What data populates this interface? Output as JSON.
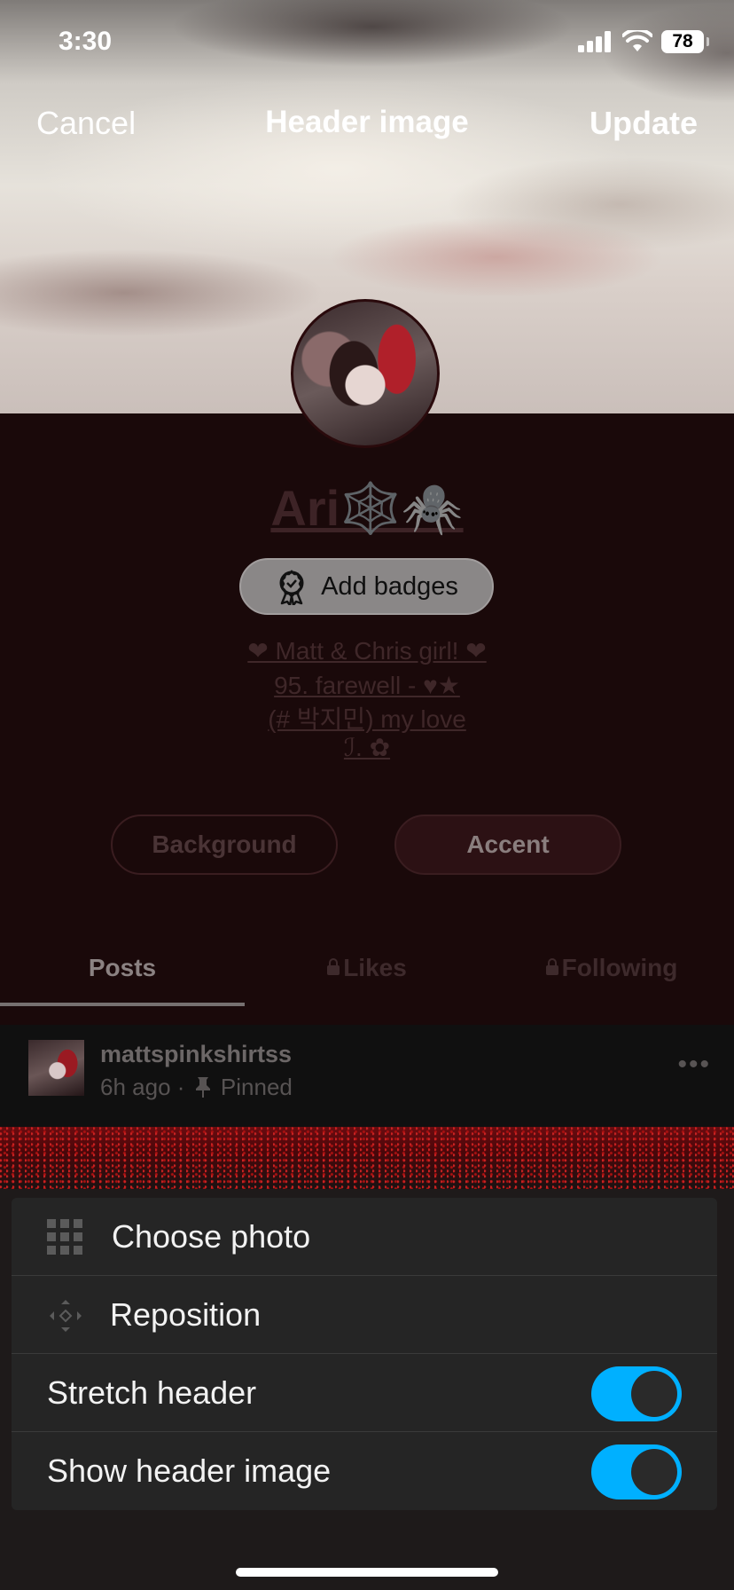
{
  "status_bar": {
    "time": "3:30",
    "battery": "78"
  },
  "nav": {
    "cancel": "Cancel",
    "title": "Header image",
    "update": "Update"
  },
  "profile": {
    "name": "Ari🕸️🕷️",
    "badges_label": "Add badges",
    "bio": [
      "❤ Matt & Chris girl! ❤",
      "95. farewell - ♥★",
      "(# 박지민) my love",
      "ℐ. ✿"
    ]
  },
  "theme_buttons": {
    "background": "Background",
    "accent": "Accent"
  },
  "tabs": {
    "posts": "Posts",
    "likes": "Likes",
    "following": "Following"
  },
  "post": {
    "username": "mattspinkshirtss",
    "time": "6h ago",
    "separator": "·",
    "pinned": "Pinned",
    "more": "•••"
  },
  "sheet": {
    "choose_photo": "Choose photo",
    "reposition": "Reposition",
    "stretch_header": {
      "label": "Stretch header",
      "on": true
    },
    "show_header_image": {
      "label": "Show header image",
      "on": true
    }
  },
  "colors": {
    "accent_toggle": "#00b0ff",
    "profile_bg": "#1a090a"
  }
}
